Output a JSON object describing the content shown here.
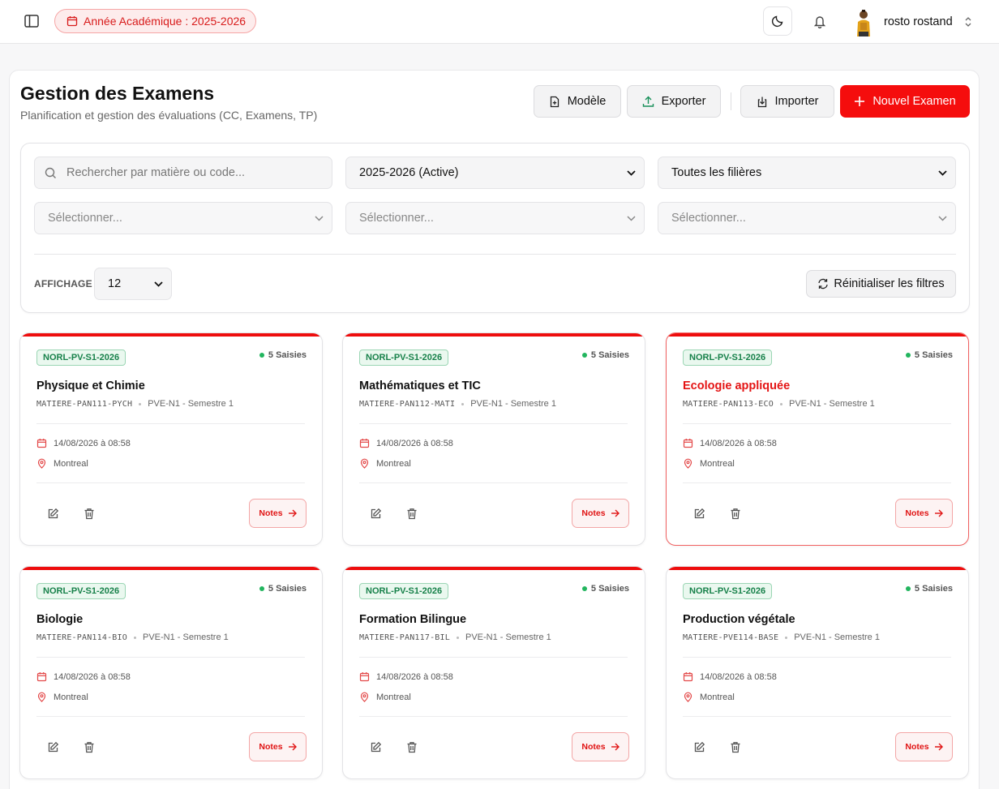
{
  "topbar": {
    "academic_year": "Année Académique : 2025-2026",
    "user_name": "rosto rostand"
  },
  "header": {
    "title": "Gestion des Examens",
    "subtitle": "Planification et gestion des évaluations (CC, Examens, TP)",
    "buttons": {
      "template": "Modèle",
      "export": "Exporter",
      "import": "Importer",
      "new_exam": "Nouvel Examen"
    }
  },
  "filters": {
    "search_placeholder": "Rechercher par matière ou code...",
    "year_value": "2025-2026 (Active)",
    "filiere_value": "Toutes les filières",
    "select_a_placeholder": "Sélectionner...",
    "select_b_placeholder": "Sélectionner...",
    "select_c_placeholder": "Sélectionner...",
    "display_label": "AFFICHAGE",
    "display_value": "12",
    "reset_label": "Réinitialiser les filtres"
  },
  "colors": {
    "accent": "#f50d0d",
    "tag_green": "#17814a",
    "status_dot": "#22b55e"
  },
  "exams": [
    {
      "tag": "NORL-PV-S1-2026",
      "saisies": "5 Saisies",
      "title": "Physique et Chimie",
      "code": "MATIERE-PAN111-PYCH",
      "level": "PVE-N1 - Semestre 1",
      "date": "14/08/2026 à 08:58",
      "location": "Montreal",
      "notes_label": "Notes",
      "active": false
    },
    {
      "tag": "NORL-PV-S1-2026",
      "saisies": "5 Saisies",
      "title": "Mathématiques et TIC",
      "code": "MATIERE-PAN112-MATI",
      "level": "PVE-N1 - Semestre 1",
      "date": "14/08/2026 à 08:58",
      "location": "Montreal",
      "notes_label": "Notes",
      "active": false
    },
    {
      "tag": "NORL-PV-S1-2026",
      "saisies": "5 Saisies",
      "title": "Ecologie appliquée",
      "code": "MATIERE-PAN113-ECO",
      "level": "PVE-N1 - Semestre 1",
      "date": "14/08/2026 à 08:58",
      "location": "Montreal",
      "notes_label": "Notes",
      "active": true
    },
    {
      "tag": "NORL-PV-S1-2026",
      "saisies": "5 Saisies",
      "title": "Biologie",
      "code": "MATIERE-PAN114-BIO",
      "level": "PVE-N1 - Semestre 1",
      "date": "14/08/2026 à 08:58",
      "location": "Montreal",
      "notes_label": "Notes",
      "active": false
    },
    {
      "tag": "NORL-PV-S1-2026",
      "saisies": "5 Saisies",
      "title": "Formation Bilingue",
      "code": "MATIERE-PAN117-BIL",
      "level": "PVE-N1 - Semestre 1",
      "date": "14/08/2026 à 08:58",
      "location": "Montreal",
      "notes_label": "Notes",
      "active": false
    },
    {
      "tag": "NORL-PV-S1-2026",
      "saisies": "5 Saisies",
      "title": "Production végétale",
      "code": "MATIERE-PVE114-BASE",
      "level": "PVE-N1 - Semestre 1",
      "date": "14/08/2026 à 08:58",
      "location": "Montreal",
      "notes_label": "Notes",
      "active": false
    }
  ]
}
